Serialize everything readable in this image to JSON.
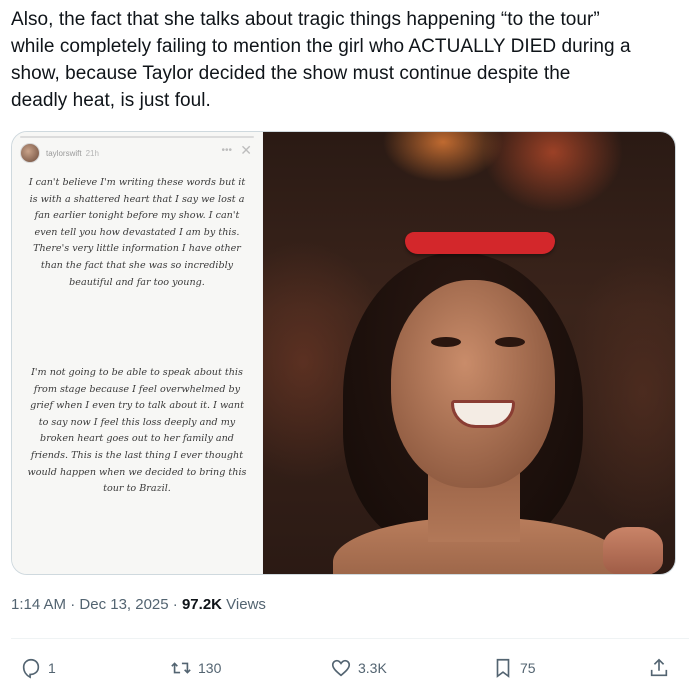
{
  "tweet": {
    "text": "Also, the fact that she talks about tragic things happening “to the tour”\nwhile completely failing to mention the girl who ACTUALLY DIED during a\nshow, because Taylor decided the show must continue despite the\ndeadly heat, is  just foul."
  },
  "story": {
    "username": "taylorswift",
    "time": "21h",
    "paragraph1": "I can't believe I'm writing these words but it is with a shattered heart that I say we lost a fan earlier tonight before my show. I can't even tell you how devastated I am by this. There's very little information I have other than the fact that she was so incredibly beautiful and far too young.",
    "paragraph2": "I'm not going to be able to speak about this from stage because I feel overwhelmed by grief when I even try to talk about it. I want to say now I feel this loss deeply and my broken heart goes out to her family and friends. This is the last thing I ever thought would happen when we decided to bring this tour to Brazil."
  },
  "meta": {
    "time": "1:14 AM",
    "separator": " · ",
    "date": "Dec 13, 2025",
    "separator2": " · ",
    "views_count": "97.2K",
    "views_label": " Views"
  },
  "actions": {
    "replies": "1",
    "reposts": "130",
    "likes": "3.3K",
    "bookmarks": "75"
  },
  "icons": {
    "reply": "reply-icon",
    "repost": "repost-icon",
    "like": "heart-icon",
    "bookmark": "bookmark-icon",
    "share": "share-icon"
  },
  "colors": {
    "text": "#0f1419",
    "secondary": "#536471",
    "border": "#cfd9de",
    "divider": "#eff3f4"
  }
}
